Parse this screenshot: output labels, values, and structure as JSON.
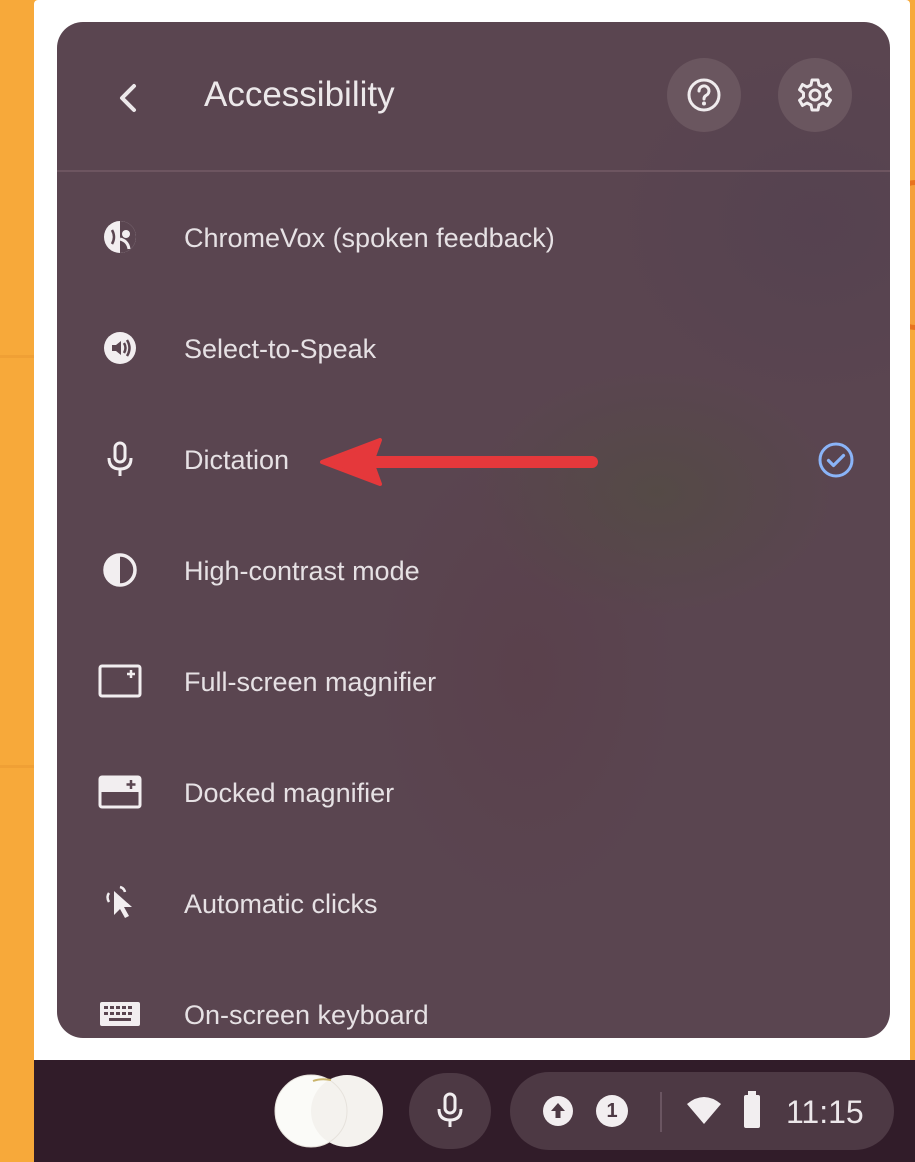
{
  "panel": {
    "title": "Accessibility",
    "back_icon": "chevron-left-icon",
    "help_icon": "help-icon",
    "settings_icon": "gear-icon"
  },
  "items": [
    {
      "label": "ChromeVox (spoken feedback)",
      "icon": "chromevox-icon",
      "checked": false
    },
    {
      "label": "Select-to-Speak",
      "icon": "select-to-speak-icon",
      "checked": false
    },
    {
      "label": "Dictation",
      "icon": "microphone-icon",
      "checked": true
    },
    {
      "label": "High-contrast mode",
      "icon": "contrast-icon",
      "checked": false
    },
    {
      "label": "Full-screen magnifier",
      "icon": "fullscreen-magnifier-icon",
      "checked": false
    },
    {
      "label": "Docked magnifier",
      "icon": "docked-magnifier-icon",
      "checked": false
    },
    {
      "label": "Automatic clicks",
      "icon": "auto-click-icon",
      "checked": false
    },
    {
      "label": "On-screen keyboard",
      "icon": "keyboard-icon",
      "checked": false
    }
  ],
  "shelf": {
    "notification_count": "1",
    "time": "11:15"
  },
  "colors": {
    "accent_check": "#8ab4f8",
    "annotation_arrow": "#e5383b",
    "panel_bg": "#5a4550",
    "shelf_bg": "#311c29",
    "desktop_bg": "#f7a93a"
  }
}
